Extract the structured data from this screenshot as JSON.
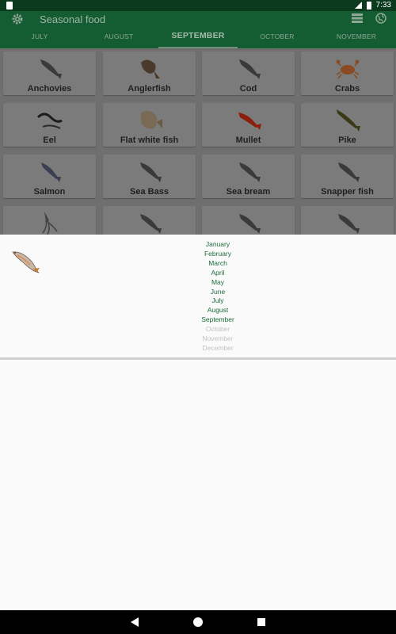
{
  "status_bar": {
    "time": "7:33"
  },
  "toolbar": {
    "title": "Seasonal food"
  },
  "tabs": [
    "JULY",
    "AUGUST",
    "SEPTEMBER",
    "OCTOBER",
    "NOVEMBER"
  ],
  "active_tab": "SEPTEMBER",
  "items": [
    {
      "label": "Anchovies",
      "icon": "anchovy-icon"
    },
    {
      "label": "Anglerfish",
      "icon": "anglerfish-icon"
    },
    {
      "label": "Cod",
      "icon": "cod-icon"
    },
    {
      "label": "Crabs",
      "icon": "crab-icon"
    },
    {
      "label": "Eel",
      "icon": "eel-icon"
    },
    {
      "label": "Flat white fish",
      "icon": "flatfish-icon"
    },
    {
      "label": "Mullet",
      "icon": "mullet-icon"
    },
    {
      "label": "Pike",
      "icon": "pike-icon"
    },
    {
      "label": "Salmon",
      "icon": "salmon-icon"
    },
    {
      "label": "Sea Bass",
      "icon": "sea-bass-icon"
    },
    {
      "label": "Sea bream",
      "icon": "sea-bream-icon"
    },
    {
      "label": "Snapper fish",
      "icon": "snapper-icon"
    },
    {
      "label": "",
      "icon": "squid-icon"
    },
    {
      "label": "",
      "icon": "fish-icon"
    },
    {
      "label": "",
      "icon": "fish-icon"
    },
    {
      "label": "",
      "icon": "fish-icon"
    }
  ],
  "detail": {
    "icon": "trout-icon",
    "months": [
      {
        "name": "January",
        "in_season": true
      },
      {
        "name": "February",
        "in_season": true
      },
      {
        "name": "March",
        "in_season": true
      },
      {
        "name": "April",
        "in_season": true
      },
      {
        "name": "May",
        "in_season": true
      },
      {
        "name": "June",
        "in_season": true
      },
      {
        "name": "July",
        "in_season": true
      },
      {
        "name": "August",
        "in_season": true
      },
      {
        "name": "September",
        "in_season": true
      },
      {
        "name": "October",
        "in_season": false
      },
      {
        "name": "November",
        "in_season": false
      },
      {
        "name": "December",
        "in_season": false
      }
    ]
  },
  "colors": {
    "toolbar": "#145c31",
    "status_bar": "#0c3a1f",
    "in_season": "#1c6b3a",
    "out_of_season": "#c2c2c2"
  }
}
